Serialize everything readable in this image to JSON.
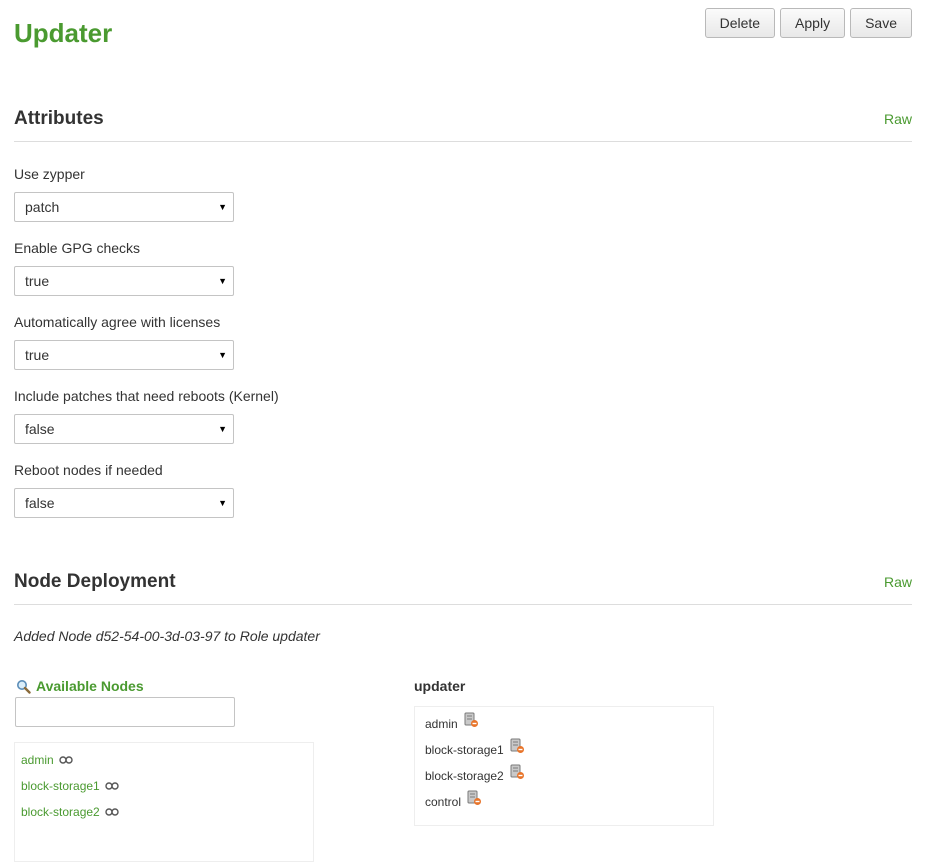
{
  "page": {
    "title": "Updater"
  },
  "toolbar": {
    "delete_label": "Delete",
    "apply_label": "Apply",
    "save_label": "Save"
  },
  "attributes": {
    "heading": "Attributes",
    "raw_label": "Raw",
    "fields": [
      {
        "label": "Use zypper",
        "value": "patch"
      },
      {
        "label": "Enable GPG checks",
        "value": "true"
      },
      {
        "label": "Automatically agree with licenses",
        "value": "true"
      },
      {
        "label": "Include patches that need reboots (Kernel)",
        "value": "false"
      },
      {
        "label": "Reboot nodes if needed",
        "value": "false"
      }
    ]
  },
  "deployment": {
    "heading": "Node Deployment",
    "raw_label": "Raw",
    "notice": "Added Node d52-54-00-3d-03-97 to Role updater",
    "available": {
      "heading": "Available Nodes",
      "search_placeholder": "",
      "nodes": [
        "admin",
        "block-storage1",
        "block-storage2"
      ]
    },
    "role": {
      "title": "updater",
      "nodes": [
        "admin",
        "block-storage1",
        "block-storage2",
        "control"
      ]
    }
  },
  "icons": {
    "search": "magnifier-icon",
    "available_node": "link-icon",
    "assigned_node": "server-remove-icon"
  },
  "colors": {
    "accent": "#4a9a30",
    "text": "#333333",
    "border": "#dddddd"
  }
}
